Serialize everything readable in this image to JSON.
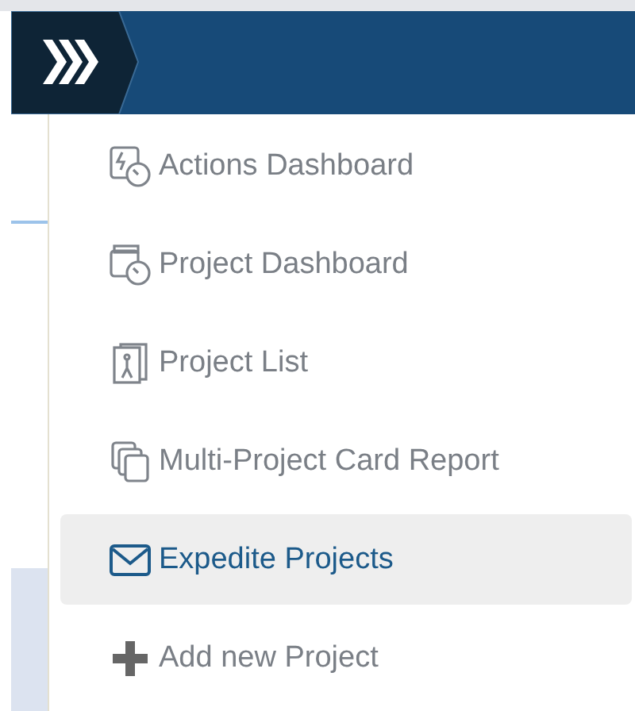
{
  "menu": {
    "items": [
      {
        "label": "Actions Dashboard",
        "kind": "actions",
        "selected": false
      },
      {
        "label": "Project Dashboard",
        "kind": "dashboard",
        "selected": false
      },
      {
        "label": "Project List",
        "kind": "list",
        "selected": false
      },
      {
        "label": "Multi-Project Card Report",
        "kind": "cards",
        "selected": false
      },
      {
        "label": "Expedite Projects",
        "kind": "mail",
        "selected": true
      },
      {
        "label": "Add new Project",
        "kind": "add",
        "selected": false
      }
    ]
  }
}
